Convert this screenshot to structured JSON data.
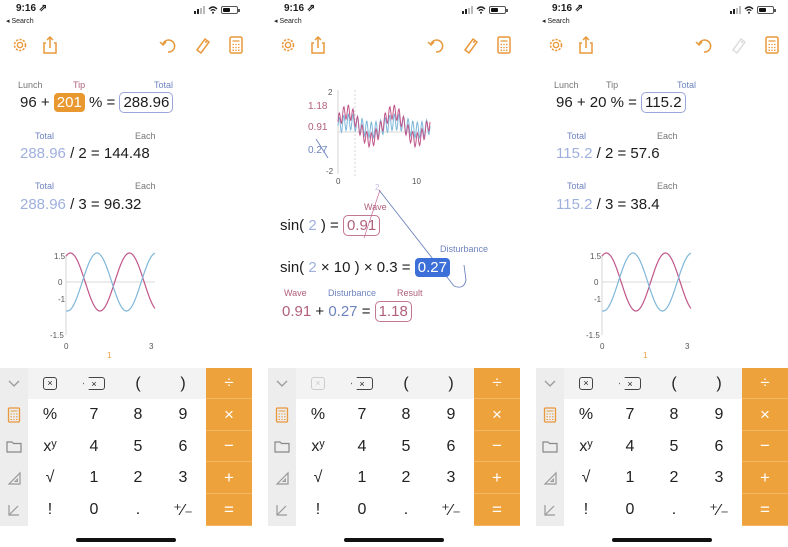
{
  "status": {
    "time": "9:16 ⇗",
    "back": "◂ Search"
  },
  "colors": {
    "orange": "#E9982F",
    "blue_hl": "#3D6FD8",
    "wave_pink": "#C0578A",
    "wave_blue": "#7FB7D9",
    "rose_text": "#B0607C",
    "blue_text": "#6E84BF"
  },
  "toolbar_icons": [
    "gear-icon",
    "share-icon",
    "undo-icon",
    "tag-icon",
    "calculator-icon"
  ],
  "p1": {
    "lunch_label": "Lunch",
    "tip_label": "Tip",
    "total_label": "Total",
    "lunch": "96",
    "op1": "+",
    "tip": "201",
    "pct": "%",
    "eq": "=",
    "total": "288.96",
    "r2_total_label": "Total",
    "r2_each_label": "Each",
    "r2_total": "288.96",
    "r2_div": "/",
    "r2_n": "2",
    "r2_eq": "=",
    "r2_each": "144.48",
    "r3_total_label": "Total",
    "r3_each_label": "Each",
    "r3_total": "288.96",
    "r3_div": "/",
    "r3_n": "3",
    "r3_eq": "=",
    "r3_each": "96.32",
    "plot": {
      "y_top": "1.5",
      "y_zero": "0",
      "y_neg": "-1",
      "y_bottom": "-1.5",
      "x_left": "0",
      "x_right": "3",
      "x_marker": "1"
    }
  },
  "p2": {
    "plot": {
      "y_top": "2",
      "y_118": "1.18",
      "y_091": "0.91",
      "y_027": "0.27",
      "y_bottom": "-2",
      "x_left": "0",
      "x_right": "10",
      "x_marker": "2"
    },
    "wave_label": "Wave",
    "sin1": "sin(",
    "sin1_arg": "2",
    "sin1_close": ")",
    "sin1_eq": "=",
    "sin1_val": "0.91",
    "dist_label": "Disturbance",
    "sin2": "sin(",
    "sin2_arg": "2",
    "sin2_mul": "×",
    "sin2_n": "10",
    "sin2_close": ")",
    "sin2_mul2": "×",
    "sin2_k": "0.3",
    "sin2_eq": "=",
    "sin2_val": "0.27",
    "r_wave_label": "Wave",
    "r_dist_label": "Disturbance",
    "r_result_label": "Result",
    "r_wave": "0.91",
    "r_plus": "+",
    "r_dist": "0.27",
    "r_eq": "=",
    "r_result": "1.18"
  },
  "p3": {
    "lunch_label": "Lunch",
    "tip_label": "Tip",
    "total_label": "Total",
    "lunch": "96",
    "op1": "+",
    "tip": "20",
    "pct": "%",
    "eq": "=",
    "total": "115.2",
    "r2_total_label": "Total",
    "r2_each_label": "Each",
    "r2_total": "115.2",
    "r2_div": "/",
    "r2_n": "2",
    "r2_eq": "=",
    "r2_each": "57.6",
    "r3_total_label": "Total",
    "r3_each_label": "Each",
    "r3_total": "115.2",
    "r3_div": "/",
    "r3_n": "3",
    "r3_eq": "=",
    "r3_each": "38.4",
    "plot": {
      "y_top": "1.5",
      "y_zero": "0",
      "y_neg": "-1",
      "y_bottom": "-1.5",
      "x_left": "0",
      "x_right": "3",
      "x_marker": "1"
    }
  },
  "keypad": {
    "top_row": [
      "( ",
      ")"
    ],
    "rows": [
      [
        "%",
        "7",
        "8",
        "9"
      ],
      [
        "xʸ",
        "4",
        "5",
        "6"
      ],
      [
        "√",
        "1",
        "2",
        "3"
      ],
      [
        "!",
        "0",
        ".",
        "⁺∕₋"
      ]
    ],
    "ops": [
      "÷",
      "×",
      "−",
      "+",
      "="
    ],
    "clear_glyph": "×",
    "side_icons": [
      "chevron-down-icon",
      "calculator-icon",
      "folder-icon",
      "triangle-ruler-icon",
      "angle-icon"
    ],
    "top_labels": [
      "(",
      ")"
    ]
  }
}
